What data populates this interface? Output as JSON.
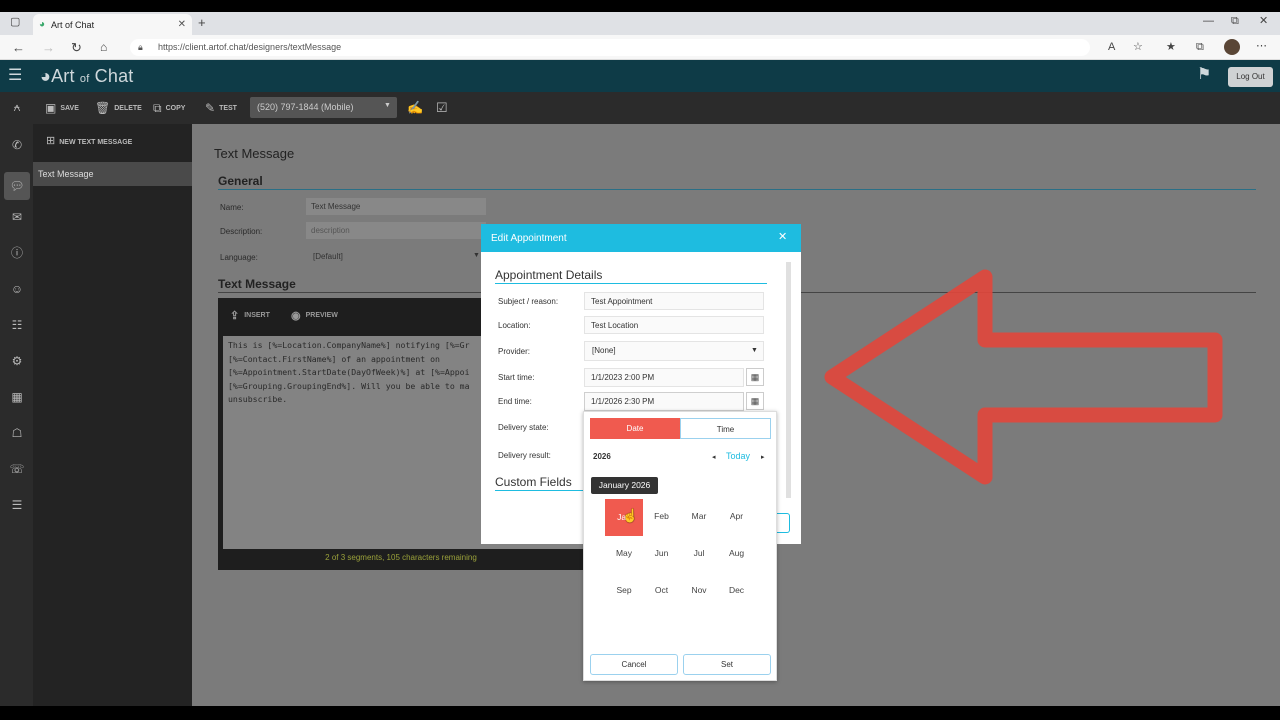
{
  "browser": {
    "tab_title": "Art of Chat",
    "url": "https://client.artof.chat/designers/textMessage"
  },
  "app": {
    "logo_main": "Art",
    "logo_of": "of",
    "logo_chat": "Chat",
    "logout": "Log Out"
  },
  "toolbar": {
    "save": "SAVE",
    "delete": "DELETE",
    "copy": "COPY",
    "test": "TEST",
    "phone": "(520) 797-1844 (Mobile)"
  },
  "sidebar": {
    "new_message": "NEW TEXT MESSAGE",
    "item": "Text Message"
  },
  "form": {
    "page_title": "Text Message",
    "general": "General",
    "name_label": "Name:",
    "name_value": "Text Message",
    "desc_label": "Description:",
    "desc_placeholder": "description",
    "lang_label": "Language:",
    "lang_value": "[Default]",
    "text_section": "Text Message",
    "insert": "INSERT",
    "preview": "PREVIEW",
    "body": "This is [%=Location.CompanyName%] notifying [%=Gr\n[%=Contact.FirstName%] of an appointment on\n[%=Appointment.StartDate(DayOfWeek)%] at [%=Appoi\n[%=Grouping.GroupingEnd%]. Will you be able to ma\nunsubscribe.",
    "segments": "2 of 3 segments, 105 characters remaining"
  },
  "modal": {
    "title": "Edit Appointment",
    "section": "Appointment Details",
    "subject_label": "Subject / reason:",
    "subject_value": "Test Appointment",
    "location_label": "Location:",
    "location_value": "Test Location",
    "provider_label": "Provider:",
    "provider_value": "[None]",
    "start_label": "Start time:",
    "start_value": "1/1/2023 2:00 PM",
    "end_label": "End time:",
    "end_value": "1/1/2026 2:30 PM",
    "delivery_state_label": "Delivery state:",
    "delivery_result_label": "Delivery result:",
    "custom_fields": "Custom Fields"
  },
  "picker": {
    "tab_date": "Date",
    "tab_time": "Time",
    "year": "2026",
    "today": "Today",
    "tooltip": "January 2026",
    "months": [
      "Jan",
      "Feb",
      "Mar",
      "Apr",
      "May",
      "Jun",
      "Jul",
      "Aug",
      "Sep",
      "Oct",
      "Nov",
      "Dec"
    ],
    "cancel": "Cancel",
    "set": "Set"
  },
  "colors": {
    "header": "#0e3b47",
    "modal_header": "#1ebce0",
    "accent_red": "#f05a4f",
    "arrow": "#e0463c"
  }
}
